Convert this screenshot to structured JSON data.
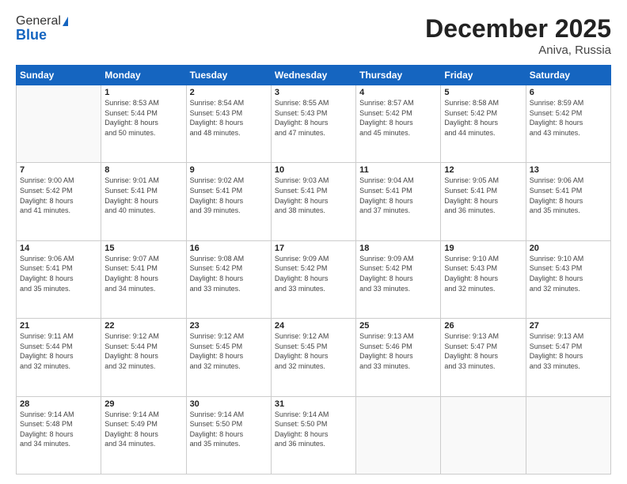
{
  "app": {
    "logo_general": "General",
    "logo_blue": "Blue",
    "title": "December 2025",
    "subtitle": "Aniva, Russia"
  },
  "calendar": {
    "headers": [
      "Sunday",
      "Monday",
      "Tuesday",
      "Wednesday",
      "Thursday",
      "Friday",
      "Saturday"
    ],
    "weeks": [
      [
        {
          "num": "",
          "info": ""
        },
        {
          "num": "1",
          "info": "Sunrise: 8:53 AM\nSunset: 5:44 PM\nDaylight: 8 hours\nand 50 minutes."
        },
        {
          "num": "2",
          "info": "Sunrise: 8:54 AM\nSunset: 5:43 PM\nDaylight: 8 hours\nand 48 minutes."
        },
        {
          "num": "3",
          "info": "Sunrise: 8:55 AM\nSunset: 5:43 PM\nDaylight: 8 hours\nand 47 minutes."
        },
        {
          "num": "4",
          "info": "Sunrise: 8:57 AM\nSunset: 5:42 PM\nDaylight: 8 hours\nand 45 minutes."
        },
        {
          "num": "5",
          "info": "Sunrise: 8:58 AM\nSunset: 5:42 PM\nDaylight: 8 hours\nand 44 minutes."
        },
        {
          "num": "6",
          "info": "Sunrise: 8:59 AM\nSunset: 5:42 PM\nDaylight: 8 hours\nand 43 minutes."
        }
      ],
      [
        {
          "num": "7",
          "info": "Sunrise: 9:00 AM\nSunset: 5:42 PM\nDaylight: 8 hours\nand 41 minutes."
        },
        {
          "num": "8",
          "info": "Sunrise: 9:01 AM\nSunset: 5:41 PM\nDaylight: 8 hours\nand 40 minutes."
        },
        {
          "num": "9",
          "info": "Sunrise: 9:02 AM\nSunset: 5:41 PM\nDaylight: 8 hours\nand 39 minutes."
        },
        {
          "num": "10",
          "info": "Sunrise: 9:03 AM\nSunset: 5:41 PM\nDaylight: 8 hours\nand 38 minutes."
        },
        {
          "num": "11",
          "info": "Sunrise: 9:04 AM\nSunset: 5:41 PM\nDaylight: 8 hours\nand 37 minutes."
        },
        {
          "num": "12",
          "info": "Sunrise: 9:05 AM\nSunset: 5:41 PM\nDaylight: 8 hours\nand 36 minutes."
        },
        {
          "num": "13",
          "info": "Sunrise: 9:06 AM\nSunset: 5:41 PM\nDaylight: 8 hours\nand 35 minutes."
        }
      ],
      [
        {
          "num": "14",
          "info": "Sunrise: 9:06 AM\nSunset: 5:41 PM\nDaylight: 8 hours\nand 35 minutes."
        },
        {
          "num": "15",
          "info": "Sunrise: 9:07 AM\nSunset: 5:41 PM\nDaylight: 8 hours\nand 34 minutes."
        },
        {
          "num": "16",
          "info": "Sunrise: 9:08 AM\nSunset: 5:42 PM\nDaylight: 8 hours\nand 33 minutes."
        },
        {
          "num": "17",
          "info": "Sunrise: 9:09 AM\nSunset: 5:42 PM\nDaylight: 8 hours\nand 33 minutes."
        },
        {
          "num": "18",
          "info": "Sunrise: 9:09 AM\nSunset: 5:42 PM\nDaylight: 8 hours\nand 33 minutes."
        },
        {
          "num": "19",
          "info": "Sunrise: 9:10 AM\nSunset: 5:43 PM\nDaylight: 8 hours\nand 32 minutes."
        },
        {
          "num": "20",
          "info": "Sunrise: 9:10 AM\nSunset: 5:43 PM\nDaylight: 8 hours\nand 32 minutes."
        }
      ],
      [
        {
          "num": "21",
          "info": "Sunrise: 9:11 AM\nSunset: 5:44 PM\nDaylight: 8 hours\nand 32 minutes."
        },
        {
          "num": "22",
          "info": "Sunrise: 9:12 AM\nSunset: 5:44 PM\nDaylight: 8 hours\nand 32 minutes."
        },
        {
          "num": "23",
          "info": "Sunrise: 9:12 AM\nSunset: 5:45 PM\nDaylight: 8 hours\nand 32 minutes."
        },
        {
          "num": "24",
          "info": "Sunrise: 9:12 AM\nSunset: 5:45 PM\nDaylight: 8 hours\nand 32 minutes."
        },
        {
          "num": "25",
          "info": "Sunrise: 9:13 AM\nSunset: 5:46 PM\nDaylight: 8 hours\nand 33 minutes."
        },
        {
          "num": "26",
          "info": "Sunrise: 9:13 AM\nSunset: 5:47 PM\nDaylight: 8 hours\nand 33 minutes."
        },
        {
          "num": "27",
          "info": "Sunrise: 9:13 AM\nSunset: 5:47 PM\nDaylight: 8 hours\nand 33 minutes."
        }
      ],
      [
        {
          "num": "28",
          "info": "Sunrise: 9:14 AM\nSunset: 5:48 PM\nDaylight: 8 hours\nand 34 minutes."
        },
        {
          "num": "29",
          "info": "Sunrise: 9:14 AM\nSunset: 5:49 PM\nDaylight: 8 hours\nand 34 minutes."
        },
        {
          "num": "30",
          "info": "Sunrise: 9:14 AM\nSunset: 5:50 PM\nDaylight: 8 hours\nand 35 minutes."
        },
        {
          "num": "31",
          "info": "Sunrise: 9:14 AM\nSunset: 5:50 PM\nDaylight: 8 hours\nand 36 minutes."
        },
        {
          "num": "",
          "info": ""
        },
        {
          "num": "",
          "info": ""
        },
        {
          "num": "",
          "info": ""
        }
      ]
    ]
  }
}
